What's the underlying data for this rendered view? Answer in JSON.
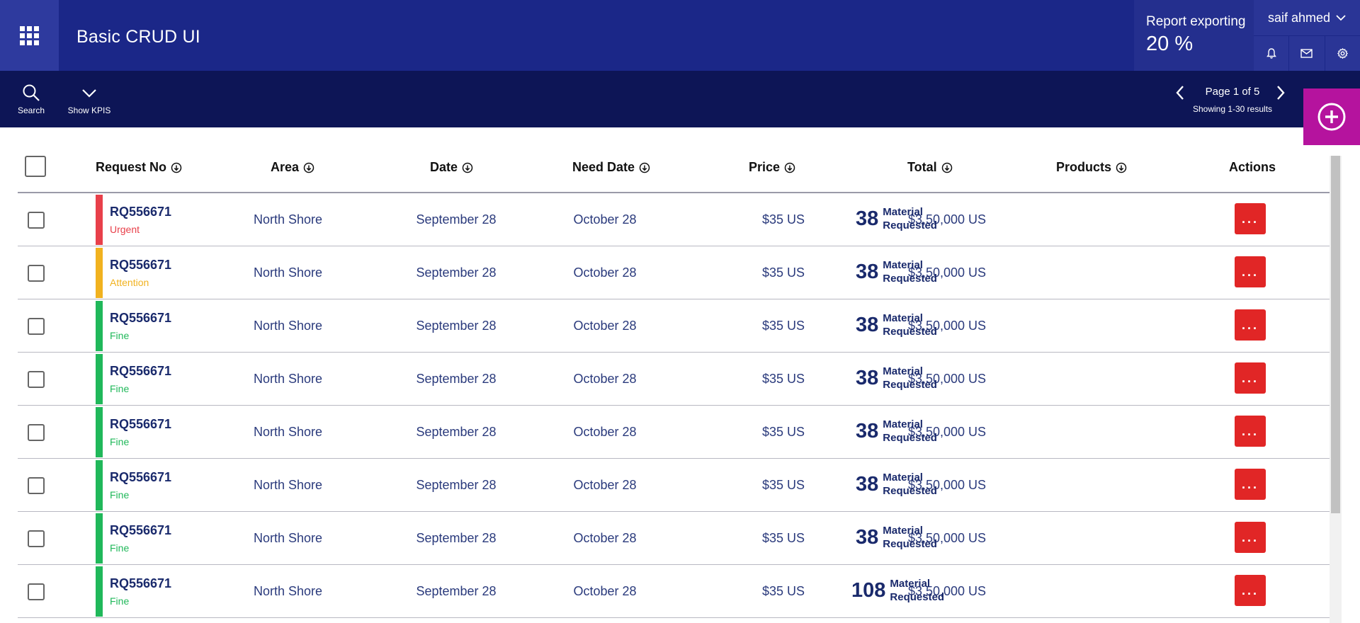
{
  "header": {
    "app_title": "Basic CRUD UI",
    "report_label": "Report exporting",
    "report_value": "20 %",
    "report_progress": 20,
    "user_name": "saif ahmed",
    "icons": [
      "apps-grid-icon",
      "bell-icon",
      "mail-icon",
      "gear-icon",
      "chevron-down-icon"
    ],
    "colors": {
      "header_bg": "#1b2788",
      "toolbar_bg": "#0d1556",
      "fab_bg": "#b5139e",
      "action_bg": "#e12626"
    }
  },
  "toolbar": {
    "search_label": "Search",
    "kpis_label": "Show KPIS",
    "page_text": "Page 1 of 5",
    "showing_text": "Showing 1-30 results"
  },
  "table": {
    "columns": [
      "Request No",
      "Area",
      "Date",
      "Need Date",
      "Price",
      "Total",
      "Products",
      "Actions"
    ],
    "status_colors": {
      "Urgent": "#e8404a",
      "Attention": "#f1b21f",
      "Fine": "#20b85a"
    },
    "rows": [
      {
        "request_no": "RQ556671",
        "status": "Urgent",
        "area": "North Shore",
        "date": "September 28",
        "need_date": "October 28",
        "price": "$35 US",
        "total": "$3,50,000 US",
        "products_count": "38",
        "products_line1": "Material",
        "products_line2": "Requested",
        "action": "..."
      },
      {
        "request_no": "RQ556671",
        "status": "Attention",
        "area": "North Shore",
        "date": "September 28",
        "need_date": "October 28",
        "price": "$35 US",
        "total": "$3,50,000 US",
        "products_count": "38",
        "products_line1": "Material",
        "products_line2": "Requested",
        "action": "..."
      },
      {
        "request_no": "RQ556671",
        "status": "Fine",
        "area": "North Shore",
        "date": "September 28",
        "need_date": "October 28",
        "price": "$35 US",
        "total": "$3,50,000 US",
        "products_count": "38",
        "products_line1": "Material",
        "products_line2": "Requested",
        "action": "..."
      },
      {
        "request_no": "RQ556671",
        "status": "Fine",
        "area": "North Shore",
        "date": "September 28",
        "need_date": "October 28",
        "price": "$35 US",
        "total": "$3,50,000 US",
        "products_count": "38",
        "products_line1": "Material",
        "products_line2": "Requested",
        "action": "..."
      },
      {
        "request_no": "RQ556671",
        "status": "Fine",
        "area": "North Shore",
        "date": "September 28",
        "need_date": "October 28",
        "price": "$35 US",
        "total": "$3,50,000 US",
        "products_count": "38",
        "products_line1": "Material",
        "products_line2": "Requested",
        "action": "..."
      },
      {
        "request_no": "RQ556671",
        "status": "Fine",
        "area": "North Shore",
        "date": "September 28",
        "need_date": "October 28",
        "price": "$35 US",
        "total": "$3,50,000 US",
        "products_count": "38",
        "products_line1": "Material",
        "products_line2": "Requested",
        "action": "..."
      },
      {
        "request_no": "RQ556671",
        "status": "Fine",
        "area": "North Shore",
        "date": "September 28",
        "need_date": "October 28",
        "price": "$35 US",
        "total": "$3,50,000 US",
        "products_count": "38",
        "products_line1": "Material",
        "products_line2": "Requested",
        "action": "..."
      },
      {
        "request_no": "RQ556671",
        "status": "Fine",
        "area": "North Shore",
        "date": "September 28",
        "need_date": "October 28",
        "price": "$35 US",
        "total": "$3,50,000 US",
        "products_count": "108",
        "products_line1": "Material",
        "products_line2": "Requested",
        "action": "..."
      }
    ]
  }
}
